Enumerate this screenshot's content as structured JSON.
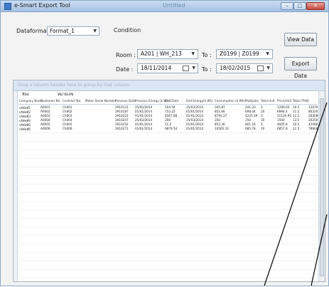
{
  "window": {
    "title": "e-Smart Export Tool",
    "faded_title": "Untitled",
    "controls": [
      "–",
      "□",
      "✕"
    ]
  },
  "filters": {
    "dataformat_label": "Dataformat :",
    "dataformat_value": "Format_1",
    "condition_label": "Condition",
    "room_label": "Room :",
    "room_from": "A201  |  WH_213",
    "to_label": "To :",
    "room_to": "Z0199  |  Z0199",
    "date_label": "Date :",
    "date_from": "18/11/2014",
    "date_to_label": "To :",
    "date_to": "18/02/2015",
    "view_button": "View Data",
    "export_button": "Export Data"
  },
  "grid": {
    "group_hint": "Drag a column header here to group by that column",
    "group_row": {
      "col1": "ห้อง",
      "col2": "หมายเลข"
    },
    "columns": [
      "Company Name",
      "Customer No.",
      "Contract No.",
      "Meter Serial Number",
      "Previous Date",
      "Previous Energy (k Wh)",
      "End Date",
      "End Energy(k Wh)",
      "Consumption (k Wh)",
      "Multiplier",
      "Total Unit",
      "Price/Unit",
      "Total (THB)"
    ],
    "rows": [
      [
        "บริษัทที่1",
        "A0001",
        "Ch001",
        "",
        "2910131",
        "25/02/2014",
        "104.54",
        "25/03/2014",
        "345.87",
        "241.33",
        "5",
        "1206.65",
        "10.5",
        "12670.82"
      ],
      [
        "บริษัทที่2",
        "A0002",
        "Ch002",
        "",
        "2910187",
        "01/01/2014",
        "153.22",
        "01/01/2014",
        "851.66",
        "698.44",
        "10",
        "6984.4",
        "11.5",
        "80320.6"
      ],
      [
        "บริษัทที่3",
        "A0003",
        "Ch003",
        "",
        "2910222",
        "01/01/2014",
        "4567.88",
        "01/01/2014",
        "8793.27",
        "4225.39",
        "5",
        "21126.95",
        "12.5",
        "264086.88"
      ],
      [
        "บริษัทที่4",
        "A0004",
        "Ch004",
        "",
        "2910247",
        "25/02/2014",
        "200",
        "25/03/2014",
        "350",
        "150",
        "10",
        "1500",
        "13.5",
        "20250"
      ],
      [
        "บริษัทที่5",
        "A0005",
        "Ch005",
        "",
        "2910252",
        "01/01/2014",
        "51.2",
        "01/01/2014",
        "852.36",
        "801.16",
        "5",
        "4005.8",
        "10.5",
        "42060.9"
      ],
      [
        "บริษัทที่6",
        "A0006",
        "Ch006",
        "",
        "2910271",
        "01/01/2014",
        "9879.54",
        "01/01/2014",
        "10565.32",
        "685.78",
        "10",
        "6857.8",
        "11.5",
        "78864.7"
      ]
    ]
  },
  "colors": {
    "accent": "#3f7bc8",
    "window_bg": "#f3f3f3",
    "group_panel": "#dbe6f4"
  }
}
